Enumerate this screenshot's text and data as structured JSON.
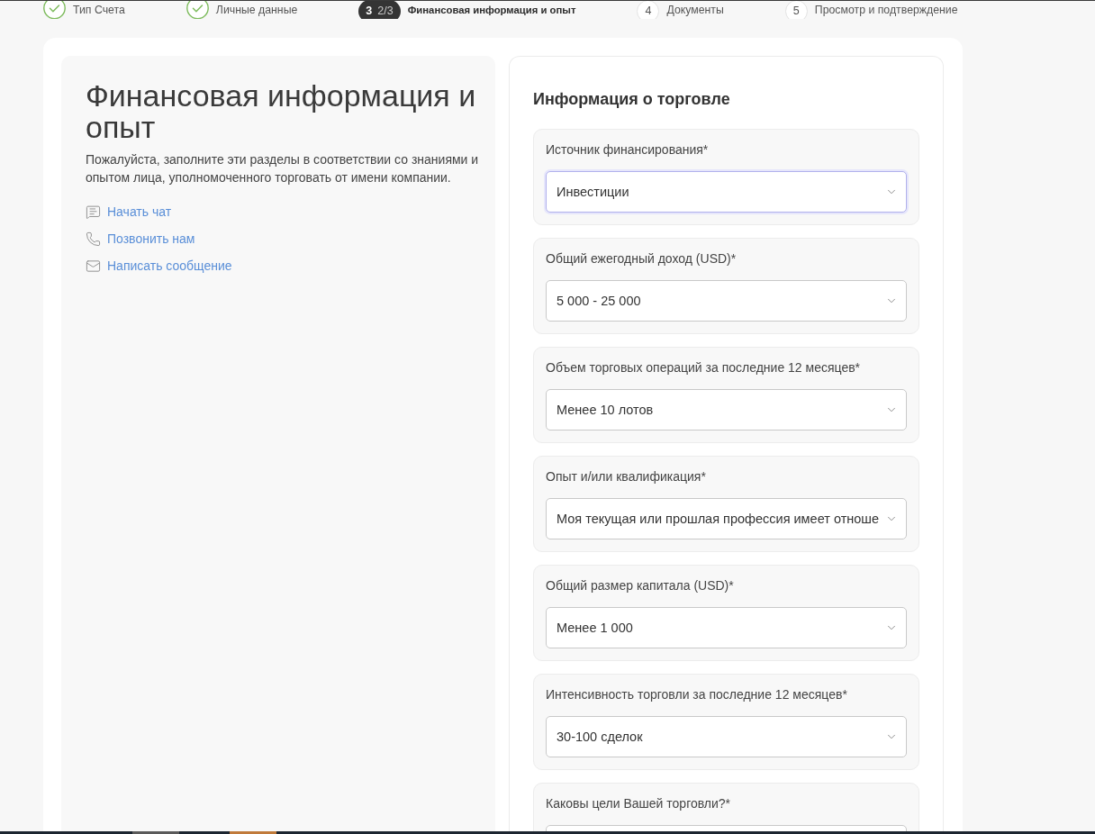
{
  "stepper": {
    "steps": [
      {
        "label": "Тип Счета",
        "completed": true,
        "selected": false
      },
      {
        "label": "Личные данные",
        "completed": true,
        "selected": false
      },
      {
        "number": "3",
        "progress": "2/3",
        "label": "Финансовая информация и опыт",
        "completed": false,
        "selected": true
      },
      {
        "number": "4",
        "label": "Документы",
        "completed": false,
        "selected": false
      },
      {
        "number": "5",
        "label": "Просмотр и подтверждение",
        "completed": false,
        "selected": false
      }
    ]
  },
  "intro": {
    "title": "Финансовая информация и опыт",
    "description": "Пожалуйста, заполните эти разделы в соответствии со знаниями и опытом лица, уполномоченного торговать от имени компании.",
    "contact_links": [
      {
        "label": "Начать чат"
      },
      {
        "label": "Позвонить нам"
      },
      {
        "label": "Написать сообщение"
      }
    ]
  },
  "trading_info": {
    "title": "Информация о торговле",
    "fields": [
      {
        "label": "Источник финансирования*",
        "value": "Инвестиции",
        "focused": true
      },
      {
        "label": "Общий ежегодный доход (USD)*",
        "value": "5 000 - 25 000",
        "focused": false
      },
      {
        "label": "Объем торговых операций за последние 12 месяцев*",
        "value": "Менее 10 лотов",
        "focused": false
      },
      {
        "label": "Опыт и/или квалификация*",
        "value": "Моя текущая или прошлая профессия имеет отноше",
        "focused": false
      },
      {
        "label": "Общий размер капитала (USD)*",
        "value": "Менее 1 000",
        "focused": false
      },
      {
        "label": "Интенсивность торговли за последние 12 месяцев*",
        "value": "30-100 сделок",
        "focused": false
      },
      {
        "label": "Каковы цели Вашей торговли?*",
        "focused": false
      }
    ]
  }
}
